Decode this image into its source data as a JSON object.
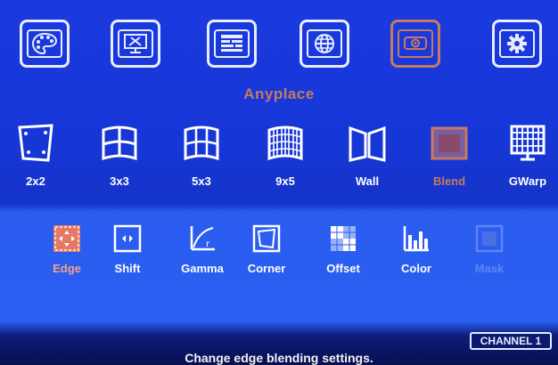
{
  "colors": {
    "background_top": "#1736d6",
    "background_panel": "#2a5cf0",
    "selected_accent": "#c77a5c",
    "edge_selected": "#f4a08a",
    "text": "#ffffff"
  },
  "top_menu": {
    "items": [
      {
        "icon": "palette-icon",
        "selected": false
      },
      {
        "icon": "monitor-tools-icon",
        "selected": false
      },
      {
        "icon": "layout-bars-icon",
        "selected": false
      },
      {
        "icon": "globe-icon",
        "selected": false
      },
      {
        "icon": "projector-icon",
        "selected": true
      },
      {
        "icon": "gear-icon",
        "selected": false
      }
    ],
    "selected_label": "Anyplace"
  },
  "mode_row": {
    "items": [
      {
        "label": "2x2",
        "icon": "quad-corners-icon",
        "selected": false
      },
      {
        "label": "3x3",
        "icon": "curved-grid-3x3-icon",
        "selected": false
      },
      {
        "label": "5x3",
        "icon": "curved-grid-5x3-icon",
        "selected": false
      },
      {
        "label": "9x5",
        "icon": "curved-grid-9x5-icon",
        "selected": false
      },
      {
        "label": "Wall",
        "icon": "wall-icon",
        "selected": false
      },
      {
        "label": "Blend",
        "icon": "blend-icon",
        "selected": true
      },
      {
        "label": "GWarp",
        "icon": "gwarp-grid-icon",
        "selected": false
      }
    ]
  },
  "blend_menu": {
    "items": [
      {
        "label": "Edge",
        "icon": "edge-icon",
        "selected": true,
        "enabled": true
      },
      {
        "label": "Shift",
        "icon": "shift-icon",
        "selected": false,
        "enabled": true
      },
      {
        "label": "Gamma",
        "icon": "gamma-curve-icon",
        "selected": false,
        "enabled": true
      },
      {
        "label": "Corner",
        "icon": "corner-icon",
        "selected": false,
        "enabled": true
      },
      {
        "label": "Offset",
        "icon": "offset-icon",
        "selected": false,
        "enabled": true
      },
      {
        "label": "Color",
        "icon": "color-bars-icon",
        "selected": false,
        "enabled": true
      },
      {
        "label": "Mask",
        "icon": "mask-icon",
        "selected": false,
        "enabled": false
      }
    ]
  },
  "status": {
    "message": "Change edge blending settings.",
    "channel": "CHANNEL 1"
  }
}
